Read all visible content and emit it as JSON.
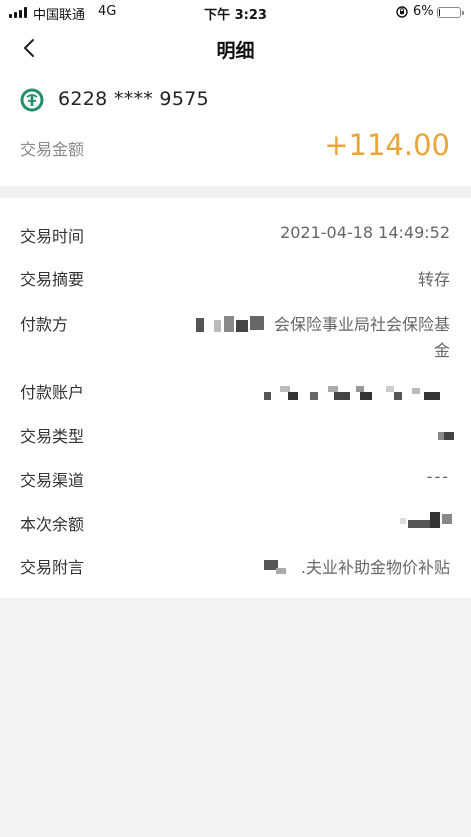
{
  "status_bar": {
    "carrier": "中国联通",
    "network": "4G",
    "time": "下午 3:23",
    "battery_percent": "6%",
    "battery_level": 0.06
  },
  "nav": {
    "back_icon": "chevron-left-icon",
    "title": "明细"
  },
  "account": {
    "bank_icon": "abc-bank-logo",
    "number": "6228 **** 9575",
    "amount_label": "交易金额",
    "amount_value": "+114.00",
    "amount_color": "#e8a53a"
  },
  "details": {
    "rows": [
      {
        "label": "交易时间",
        "value": "2021-04-18 14:49:52"
      },
      {
        "label": "交易摘要",
        "value": "转存"
      },
      {
        "label": "付款方",
        "value_line1": "会保险事业局社会保险基",
        "value_line2": "金"
      },
      {
        "label": "付款账户",
        "value": ""
      },
      {
        "label": "交易类型",
        "value": ""
      },
      {
        "label": "交易渠道",
        "value": "---"
      },
      {
        "label": "本次余额",
        "value": ""
      },
      {
        "label": "交易附言",
        "value": ".夫业补助金物价补贴"
      }
    ]
  }
}
